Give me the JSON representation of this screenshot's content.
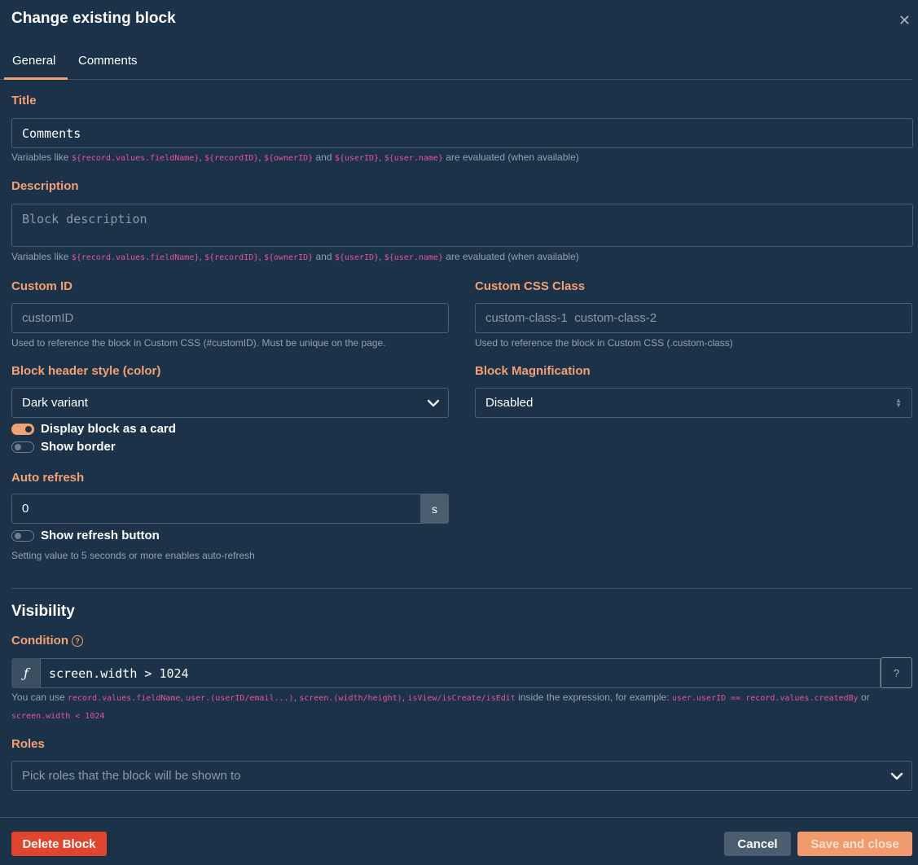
{
  "modal": {
    "title": "Change existing block",
    "close_icon": "close-icon"
  },
  "tabs": [
    {
      "label": "General",
      "active": true
    },
    {
      "label": "Comments",
      "active": false
    }
  ],
  "title_field": {
    "label": "Title",
    "value": "Comments",
    "hint": {
      "prefix": "Variables like ",
      "var1": "${record.values.fieldName}",
      "sep1": ", ",
      "var2": "${recordID}",
      "sep2": ", ",
      "var3": "${ownerID}",
      "and": " and ",
      "var4": "${userID}",
      "sep3": ", ",
      "var5": "${user.name}",
      "suffix": " are evaluated (when available)"
    }
  },
  "description_field": {
    "label": "Description",
    "placeholder": "Block description",
    "hint": {
      "prefix": "Variables like ",
      "var1": "${record.values.fieldName}",
      "sep1": ", ",
      "var2": "${recordID}",
      "sep2": ", ",
      "var3": "${ownerID}",
      "and": " and ",
      "var4": "${userID}",
      "sep3": ", ",
      "var5": "${user.name}",
      "suffix": " are evaluated (when available)"
    }
  },
  "custom_id": {
    "label": "Custom ID",
    "placeholder": "customID",
    "hint": "Used to reference the block in Custom CSS (#customID). Must be unique on the page."
  },
  "custom_css": {
    "label": "Custom CSS Class",
    "placeholder": "custom-class-1  custom-class-2",
    "hint": "Used to reference the block in Custom CSS (.custom-class)"
  },
  "header_style": {
    "label": "Block header style (color)",
    "selected": "Dark variant"
  },
  "magnification": {
    "label": "Block Magnification",
    "selected": "Disabled"
  },
  "toggles": {
    "card": {
      "label": "Display block as a card",
      "on": true
    },
    "border": {
      "label": "Show border",
      "on": false
    },
    "refresh_button": {
      "label": "Show refresh button",
      "on": false
    }
  },
  "auto_refresh": {
    "label": "Auto refresh",
    "value": "0",
    "unit": "s",
    "hint": "Setting value to 5 seconds or more enables auto-refresh"
  },
  "visibility": {
    "title": "Visibility",
    "condition_label": "Condition",
    "condition_help_icon": "question-circle-icon",
    "fx_symbol": "ƒ",
    "expression": "screen.width > 1024",
    "help_button": "?",
    "hint": {
      "prefix": "You can use ",
      "c1": "record.values.fieldName",
      "s1": ", ",
      "c2": "user.(userID/email...)",
      "s2": ", ",
      "c3": "screen.(width/height)",
      "s3": ", ",
      "c4": "isView/isCreate/isEdit",
      "mid": " inside the expression, for example: ",
      "c5": "user.userID == record.values.createdBy",
      "or": " or",
      "c6": "screen.width < 1024"
    },
    "roles_label": "Roles",
    "roles_placeholder": "Pick roles that the block will be shown to"
  },
  "footer": {
    "delete": "Delete Block",
    "cancel": "Cancel",
    "save": "Save and close"
  },
  "colors": {
    "background": "#1b3249",
    "accent": "#f2a173",
    "danger": "#e2452d",
    "code": "#e8549c"
  }
}
